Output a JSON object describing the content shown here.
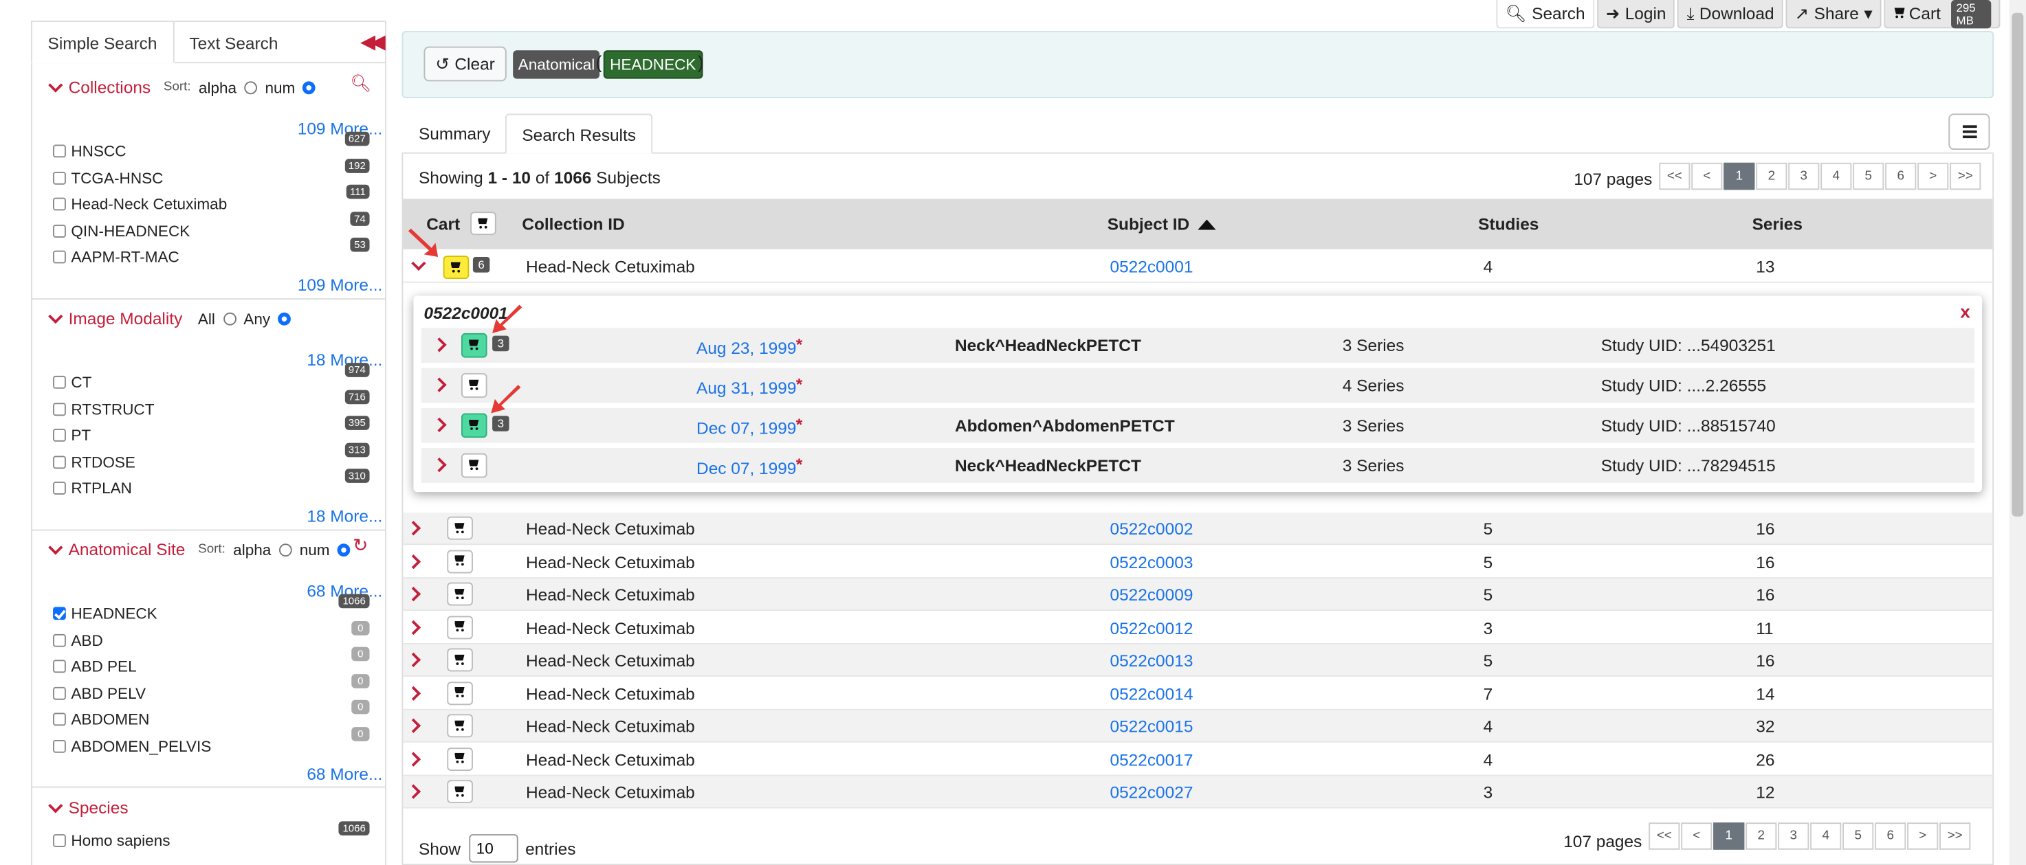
{
  "topnav": {
    "search": "Search",
    "login": "Login",
    "download": "Download",
    "share": "Share",
    "cart": "Cart",
    "cart_size": "295 MB"
  },
  "sidebar": {
    "tabs": [
      "Simple Search",
      "Text Search"
    ],
    "collections": {
      "title": "Collections",
      "sort_label": "Sort:",
      "sort_alpha": "alpha",
      "sort_num": "num",
      "more_top": "109 More...",
      "more_bottom": "109 More...",
      "items": [
        {
          "label": "HNSCC",
          "count": "627"
        },
        {
          "label": "TCGA-HNSC",
          "count": "192"
        },
        {
          "label": "Head-Neck Cetuximab",
          "count": "111"
        },
        {
          "label": "QIN-HEADNECK",
          "count": "74"
        },
        {
          "label": "AAPM-RT-MAC",
          "count": "53"
        }
      ]
    },
    "modality": {
      "title": "Image Modality",
      "all": "All",
      "any": "Any",
      "more_top": "18 More...",
      "more_bottom": "18 More...",
      "items": [
        {
          "label": "CT",
          "count": "974"
        },
        {
          "label": "RTSTRUCT",
          "count": "716"
        },
        {
          "label": "PT",
          "count": "395"
        },
        {
          "label": "RTDOSE",
          "count": "313"
        },
        {
          "label": "RTPLAN",
          "count": "310"
        }
      ]
    },
    "anatomical": {
      "title": "Anatomical Site",
      "sort_label": "Sort:",
      "sort_alpha": "alpha",
      "sort_num": "num",
      "more_top": "68 More...",
      "more_bottom": "68 More...",
      "items": [
        {
          "label": "HEADNECK",
          "count": "1066",
          "checked": true
        },
        {
          "label": "ABD",
          "count": "0"
        },
        {
          "label": "ABD PEL",
          "count": "0"
        },
        {
          "label": "ABD PELV",
          "count": "0"
        },
        {
          "label": "ABDOMEN",
          "count": "0"
        },
        {
          "label": "ABDOMEN_PELVIS",
          "count": "0"
        }
      ]
    },
    "species": {
      "title": "Species",
      "items": [
        {
          "label": "Homo sapiens",
          "count": "1066"
        }
      ]
    }
  },
  "criteria": {
    "clear": "Clear",
    "tag1": "Anatomical",
    "paren_open": "(",
    "tag2": "HEADNECK",
    "paren_close": ")"
  },
  "main_tabs": [
    "Summary",
    "Search Results"
  ],
  "results": {
    "showing_pre": "Showing",
    "range": "1 - 10",
    "of": "of",
    "total": "1066",
    "unit": "Subjects",
    "pages_label": "107 pages",
    "pager": [
      "<<",
      "<",
      "1",
      "2",
      "3",
      "4",
      "5",
      "6",
      ">",
      ">>"
    ],
    "headers": {
      "cart": "Cart",
      "collection": "Collection ID",
      "subject": "Subject ID",
      "studies": "Studies",
      "series": "Series"
    },
    "expanded_row": {
      "collection": "Head-Neck Cetuximab",
      "subject": "0522c0001",
      "studies": "4",
      "series": "13",
      "cart_count": "6"
    },
    "popup": {
      "title": "0522c0001",
      "close": "x",
      "rows": [
        {
          "date": "Aug 23, 1999",
          "desc": "Neck^HeadNeckPETCT",
          "series": "3 Series",
          "uid": "Study UID: ...54903251",
          "count": "3",
          "in_cart": true
        },
        {
          "date": "Aug 31, 1999",
          "desc": "",
          "series": "4 Series",
          "uid": "Study UID: ....2.26555",
          "count": "",
          "in_cart": false
        },
        {
          "date": "Dec 07, 1999",
          "desc": "Abdomen^AbdomenPETCT",
          "series": "3 Series",
          "uid": "Study UID: ...88515740",
          "count": "3",
          "in_cart": true
        },
        {
          "date": "Dec 07, 1999",
          "desc": "Neck^HeadNeckPETCT",
          "series": "3 Series",
          "uid": "Study UID: ...78294515",
          "count": "",
          "in_cart": false
        }
      ]
    },
    "rows": [
      {
        "collection": "Head-Neck Cetuximab",
        "subject": "0522c0002",
        "studies": "5",
        "series": "16"
      },
      {
        "collection": "Head-Neck Cetuximab",
        "subject": "0522c0003",
        "studies": "5",
        "series": "16"
      },
      {
        "collection": "Head-Neck Cetuximab",
        "subject": "0522c0009",
        "studies": "5",
        "series": "16"
      },
      {
        "collection": "Head-Neck Cetuximab",
        "subject": "0522c0012",
        "studies": "3",
        "series": "11"
      },
      {
        "collection": "Head-Neck Cetuximab",
        "subject": "0522c0013",
        "studies": "5",
        "series": "16"
      },
      {
        "collection": "Head-Neck Cetuximab",
        "subject": "0522c0014",
        "studies": "7",
        "series": "14"
      },
      {
        "collection": "Head-Neck Cetuximab",
        "subject": "0522c0015",
        "studies": "4",
        "series": "32"
      },
      {
        "collection": "Head-Neck Cetuximab",
        "subject": "0522c0017",
        "studies": "4",
        "series": "26"
      },
      {
        "collection": "Head-Neck Cetuximab",
        "subject": "0522c0027",
        "studies": "3",
        "series": "12"
      }
    ],
    "footer": {
      "show": "Show",
      "entries_value": "10",
      "entries": "entries"
    }
  },
  "colors": {
    "accent": "#c41e3a",
    "link": "#1a73e8",
    "tag_anatomical": "#555555",
    "tag_headneck": "#2e6b2e",
    "cart_in": "#4dd9a0",
    "cart_yellow": "#ffeb3b"
  }
}
